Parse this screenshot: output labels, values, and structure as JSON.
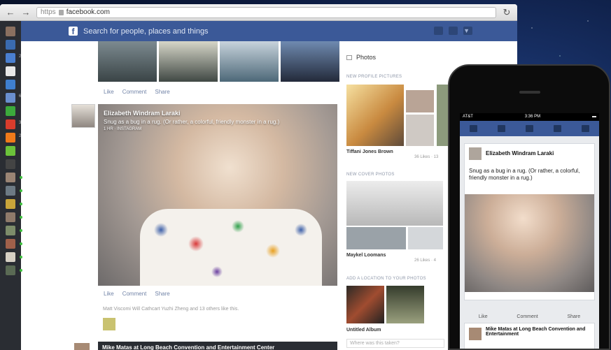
{
  "browser": {
    "url_protocol": "https",
    "url_host": "facebook.com"
  },
  "facebook": {
    "search_placeholder": "Search for people, places and things",
    "logo": "f"
  },
  "sidebar": {
    "counts": [
      "2",
      "6",
      "3",
      "2"
    ],
    "colors": {
      "dark": "#2a2d33",
      "online": "#3fbf3f"
    }
  },
  "feed": {
    "top_actions": {
      "like": "Like",
      "comment": "Comment",
      "share": "Share"
    },
    "post": {
      "author": "Elizabeth Windram Laraki",
      "text": "Snug as a bug in a rug. (Or rather, a colorful, friendly monster in a rug.)",
      "meta": "1 HR · INSTAGRAM",
      "actions": {
        "like": "Like",
        "comment": "Comment",
        "share": "Share"
      },
      "likers": "Matt Viscomi  Will Cathcart  Yuzhi Zheng  and 13 others like this."
    },
    "post2": {
      "title": "Mike Matas at Long Beach Convention and Entertainment Center"
    }
  },
  "right_column": {
    "title": "Photos",
    "profile_section": "NEW PROFILE PICTURES",
    "profile_name": "Tiffani Jones Brown",
    "profile_likes": "36 Likes · 13",
    "cover_section": "NEW COVER PHOTOS",
    "cover_name": "Maykel Loomans",
    "cover_likes": "26 Likes · 4",
    "location_section": "ADD A LOCATION TO YOUR PHOTOS",
    "album_name": "Untitled Album",
    "location_input": "Where was this taken?"
  },
  "phone": {
    "carrier": "AT&T",
    "time": "3:36 PM",
    "post_author": "Elizabeth Windram Laraki",
    "post_text": "Snug as a bug in a rug. (Or rather, a colorful, friendly monster in a rug.)",
    "actions": {
      "like": "Like",
      "comment": "Comment",
      "share": "Share"
    },
    "post2_title": "Mike Matas at Long Beach Convention and Entertainment"
  },
  "colors": {
    "facebook_blue": "#3b5998",
    "link_blue": "#7385a8"
  }
}
